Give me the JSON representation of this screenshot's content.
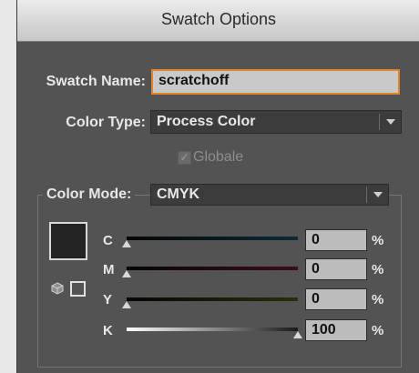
{
  "dialog": {
    "title": "Swatch Options"
  },
  "swatch_name": {
    "label": "Swatch Name:",
    "value": "scratchoff"
  },
  "color_type": {
    "label": "Color Type:",
    "value": "Process Color"
  },
  "global": {
    "label": "Globale",
    "checked": true,
    "enabled": false
  },
  "color_mode": {
    "label": "Color Mode:",
    "value": "CMYK"
  },
  "channels": [
    {
      "label": "C",
      "value": "0",
      "unit": "%",
      "level": 0,
      "color": "#0d2a33"
    },
    {
      "label": "M",
      "value": "0",
      "unit": "%",
      "level": 0,
      "color": "#3a0d1a"
    },
    {
      "label": "Y",
      "value": "0",
      "unit": "%",
      "level": 0,
      "color": "#2b2e0d"
    },
    {
      "label": "K",
      "value": "100",
      "unit": "%",
      "level": 100,
      "color": "#ffffff"
    }
  ],
  "colors": {
    "accent_border": "#e3832b",
    "dialog_bg": "#535353",
    "swatch_fill": "#232323"
  },
  "icons": {
    "checkmark": "check-icon",
    "dropdown": "chevron-down-icon",
    "gamut": "cube-icon",
    "web_safe": "square-icon"
  }
}
